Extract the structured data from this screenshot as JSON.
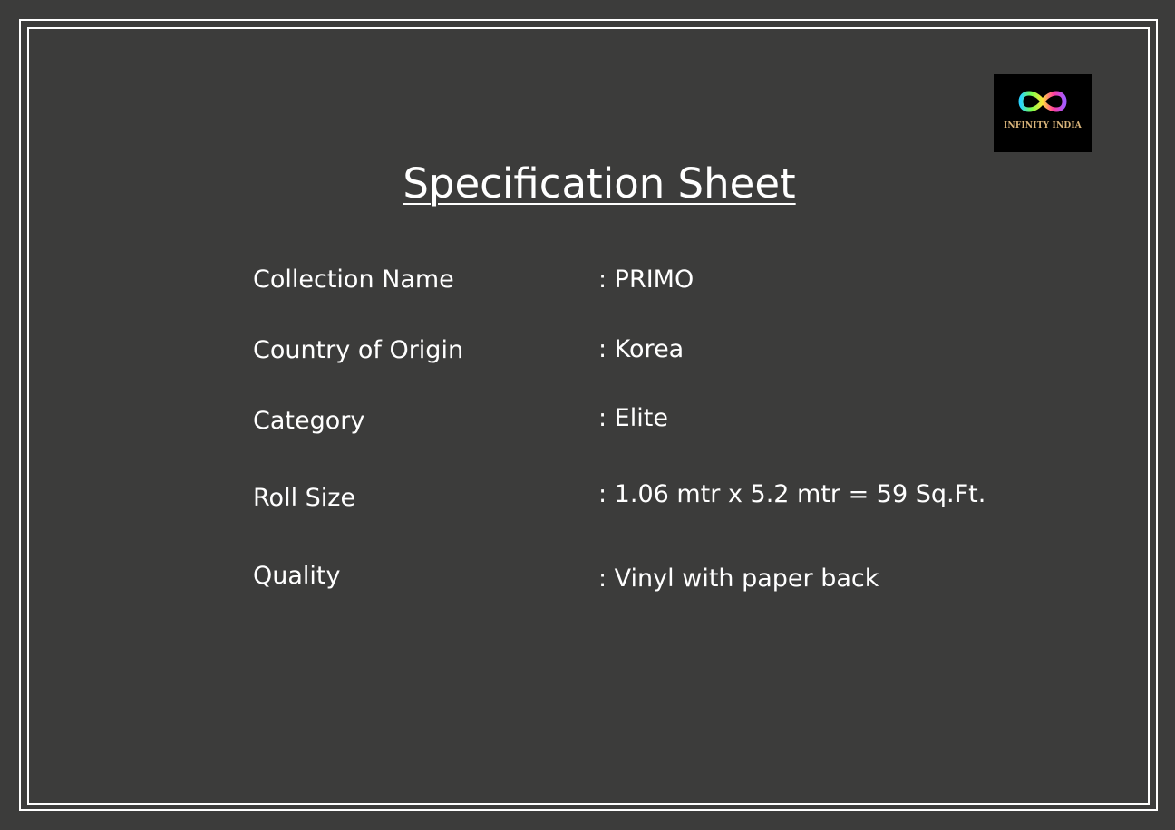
{
  "logo": {
    "text": "INFINITY INDIA"
  },
  "title": "Specification Sheet",
  "specs": [
    {
      "label": "Collection Name",
      "value": ": PRIMO"
    },
    {
      "label": "Country of Origin",
      "value": ": Korea"
    },
    {
      "label": "Category",
      "value": ": Elite"
    },
    {
      "label": "Roll Size",
      "value": ": 1.06 mtr x 5.2 mtr = 59 Sq.Ft."
    },
    {
      "label": "Quality",
      "value": ": Vinyl with paper back"
    }
  ],
  "colors": {
    "background": "#3c3c3b",
    "text": "#ffffff",
    "logo_text": "#d9b47a"
  }
}
